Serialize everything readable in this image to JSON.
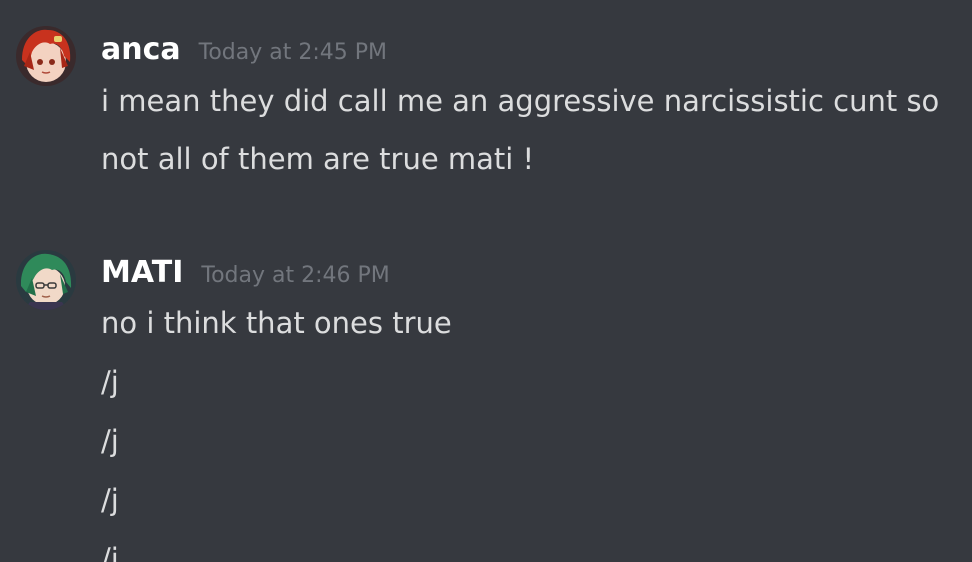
{
  "messages": [
    {
      "author": "anca",
      "timestamp": "Today at 2:45 PM",
      "avatar_icon": "red-haired-character-avatar",
      "lines": [
        "i mean they did call me an aggressive narcissistic cunt so",
        "not all of them are true mati !"
      ]
    },
    {
      "author": "MATI",
      "timestamp": "Today at 2:46 PM",
      "avatar_icon": "green-haired-character-avatar",
      "lines": [
        "no i think that ones true",
        "/j",
        "/j",
        "/j",
        "/j"
      ]
    }
  ],
  "colors": {
    "background": "#36393f",
    "username": "#ffffff",
    "timestamp": "#72767d",
    "message_text": "#dcddde"
  }
}
